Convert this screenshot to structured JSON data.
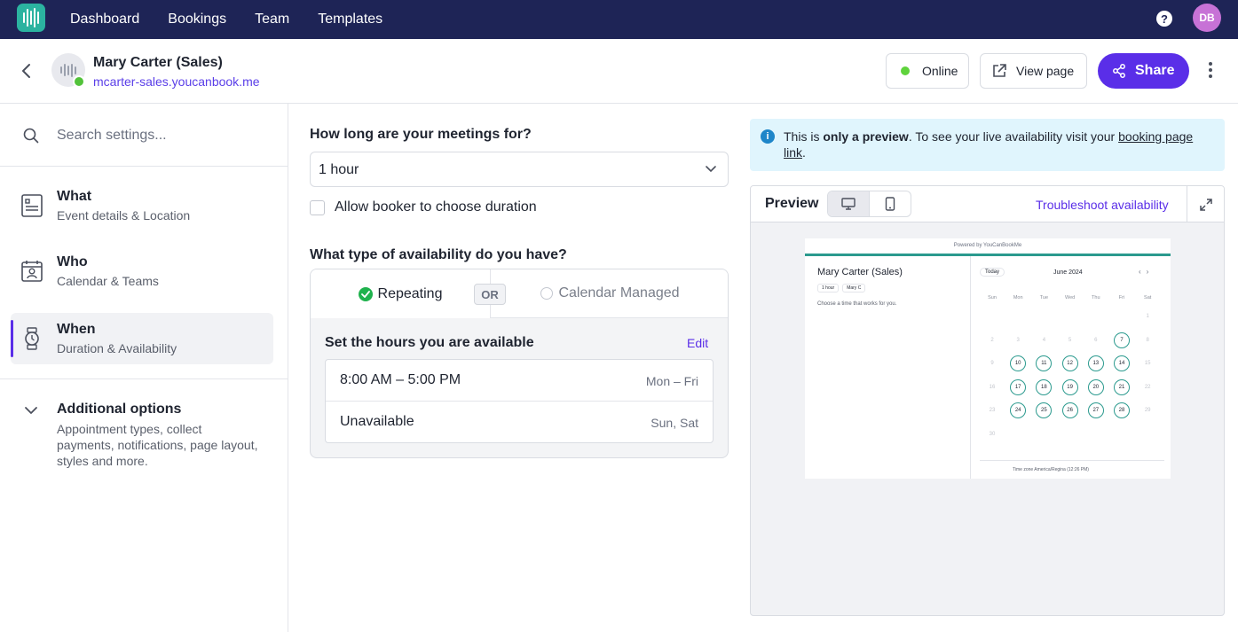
{
  "nav": {
    "links": [
      "Dashboard",
      "Bookings",
      "Team",
      "Templates"
    ],
    "help_label": "?",
    "user_initials": "DB"
  },
  "header": {
    "page_name": "Mary Carter (Sales)",
    "page_url": "mcarter-sales.youcanbook.me",
    "status_label": "Online",
    "view_page_label": "View page",
    "share_label": "Share"
  },
  "sidebar": {
    "search_placeholder": "Search settings...",
    "items": [
      {
        "title": "What",
        "subtitle": "Event details & Location"
      },
      {
        "title": "Who",
        "subtitle": "Calendar & Teams"
      },
      {
        "title": "When",
        "subtitle": "Duration & Availability"
      }
    ],
    "additional": {
      "title": "Additional options",
      "subtitle": "Appointment types, collect payments, notifications, page layout, styles and more."
    }
  },
  "main": {
    "duration_question": "How long are your meetings for?",
    "duration_value": "1 hour",
    "allow_booker_label": "Allow booker to choose duration",
    "availability_question": "What type of availability do you have?",
    "tab_repeating": "Repeating",
    "or_label": "OR",
    "tab_calendar": "Calendar Managed",
    "hours_title": "Set the hours you are available",
    "edit_label": "Edit",
    "hours": [
      {
        "time": "8:00 AM – 5:00 PM",
        "days": "Mon – Fri"
      },
      {
        "time": "Unavailable",
        "days": "Sun, Sat"
      }
    ]
  },
  "notice": {
    "pre": "This is ",
    "bold": "only a preview",
    "mid": ". To see your live availability visit your ",
    "link": "booking page link",
    "post": "."
  },
  "preview": {
    "title": "Preview",
    "troubleshoot_label": "Troubleshoot availability",
    "mini": {
      "powered": "Powered by YouCanBookMe",
      "name": "Mary Carter (Sales)",
      "duration": "1 hour",
      "host": "Mary C",
      "choose": "Choose a time that works for you.",
      "today": "Today",
      "month": "June 2024",
      "weekdays": [
        "Sun",
        "Mon",
        "Tue",
        "Wed",
        "Thu",
        "Fri",
        "Sat"
      ],
      "timezone": "Time zone   America/Regina (12:26 PM)",
      "days": [
        {
          "d": "1",
          "c": 6,
          "r": 0,
          "a": false
        },
        {
          "d": "2",
          "c": 0,
          "r": 1,
          "a": false
        },
        {
          "d": "3",
          "c": 1,
          "r": 1,
          "a": false
        },
        {
          "d": "4",
          "c": 2,
          "r": 1,
          "a": false
        },
        {
          "d": "5",
          "c": 3,
          "r": 1,
          "a": false
        },
        {
          "d": "6",
          "c": 4,
          "r": 1,
          "a": false
        },
        {
          "d": "7",
          "c": 5,
          "r": 1,
          "a": true
        },
        {
          "d": "8",
          "c": 6,
          "r": 1,
          "a": false
        },
        {
          "d": "9",
          "c": 0,
          "r": 2,
          "a": false
        },
        {
          "d": "10",
          "c": 1,
          "r": 2,
          "a": true
        },
        {
          "d": "11",
          "c": 2,
          "r": 2,
          "a": true
        },
        {
          "d": "12",
          "c": 3,
          "r": 2,
          "a": true
        },
        {
          "d": "13",
          "c": 4,
          "r": 2,
          "a": true
        },
        {
          "d": "14",
          "c": 5,
          "r": 2,
          "a": true
        },
        {
          "d": "15",
          "c": 6,
          "r": 2,
          "a": false
        },
        {
          "d": "16",
          "c": 0,
          "r": 3,
          "a": false
        },
        {
          "d": "17",
          "c": 1,
          "r": 3,
          "a": true
        },
        {
          "d": "18",
          "c": 2,
          "r": 3,
          "a": true
        },
        {
          "d": "19",
          "c": 3,
          "r": 3,
          "a": true
        },
        {
          "d": "20",
          "c": 4,
          "r": 3,
          "a": true
        },
        {
          "d": "21",
          "c": 5,
          "r": 3,
          "a": true
        },
        {
          "d": "22",
          "c": 6,
          "r": 3,
          "a": false
        },
        {
          "d": "23",
          "c": 0,
          "r": 4,
          "a": false
        },
        {
          "d": "24",
          "c": 1,
          "r": 4,
          "a": true
        },
        {
          "d": "25",
          "c": 2,
          "r": 4,
          "a": true
        },
        {
          "d": "26",
          "c": 3,
          "r": 4,
          "a": true
        },
        {
          "d": "27",
          "c": 4,
          "r": 4,
          "a": true
        },
        {
          "d": "28",
          "c": 5,
          "r": 4,
          "a": true
        },
        {
          "d": "29",
          "c": 6,
          "r": 4,
          "a": false
        },
        {
          "d": "30",
          "c": 0,
          "r": 5,
          "a": false
        }
      ]
    }
  },
  "colors": {
    "nav_bg": "#1e2456",
    "accent": "#5a2ee8",
    "online": "#52c23a",
    "brand_teal": "#2bb3a0"
  }
}
